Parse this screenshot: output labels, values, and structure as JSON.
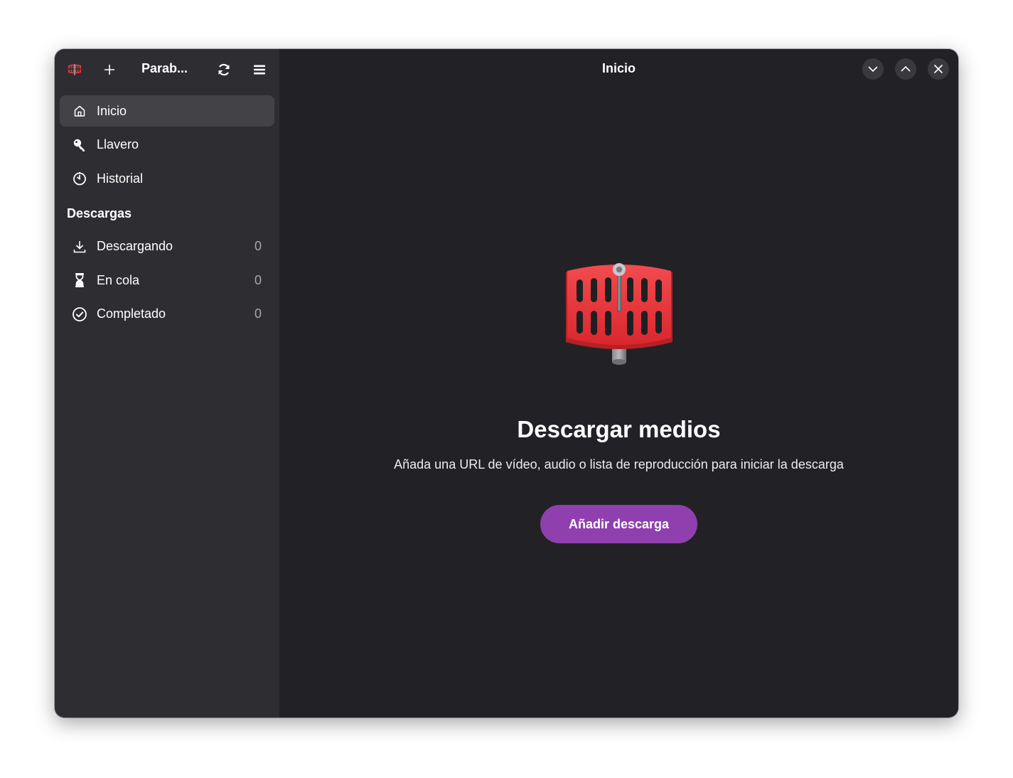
{
  "sidebar": {
    "title": "Parab...",
    "nav": [
      {
        "label": "Inicio",
        "icon": "home-icon"
      },
      {
        "label": "Llavero",
        "icon": "key-icon"
      },
      {
        "label": "Historial",
        "icon": "clock-icon"
      }
    ],
    "section_title": "Descargas",
    "downloads": [
      {
        "label": "Descargando",
        "count": "0",
        "icon": "download-icon"
      },
      {
        "label": "En cola",
        "count": "0",
        "icon": "hourglass-icon"
      },
      {
        "label": "Completado",
        "count": "0",
        "icon": "check-circle-icon"
      }
    ]
  },
  "main": {
    "title": "Inicio",
    "status_title": "Descargar medios",
    "status_description": "Añada una URL de vídeo, audio o lista de reproducción para iniciar la descarga",
    "add_button_label": "Añadir descarga"
  },
  "colors": {
    "sidebar_bg": "#2e2e32",
    "main_bg": "#222226",
    "accent": "#8f3fae",
    "logo_red": "#e8333a"
  }
}
